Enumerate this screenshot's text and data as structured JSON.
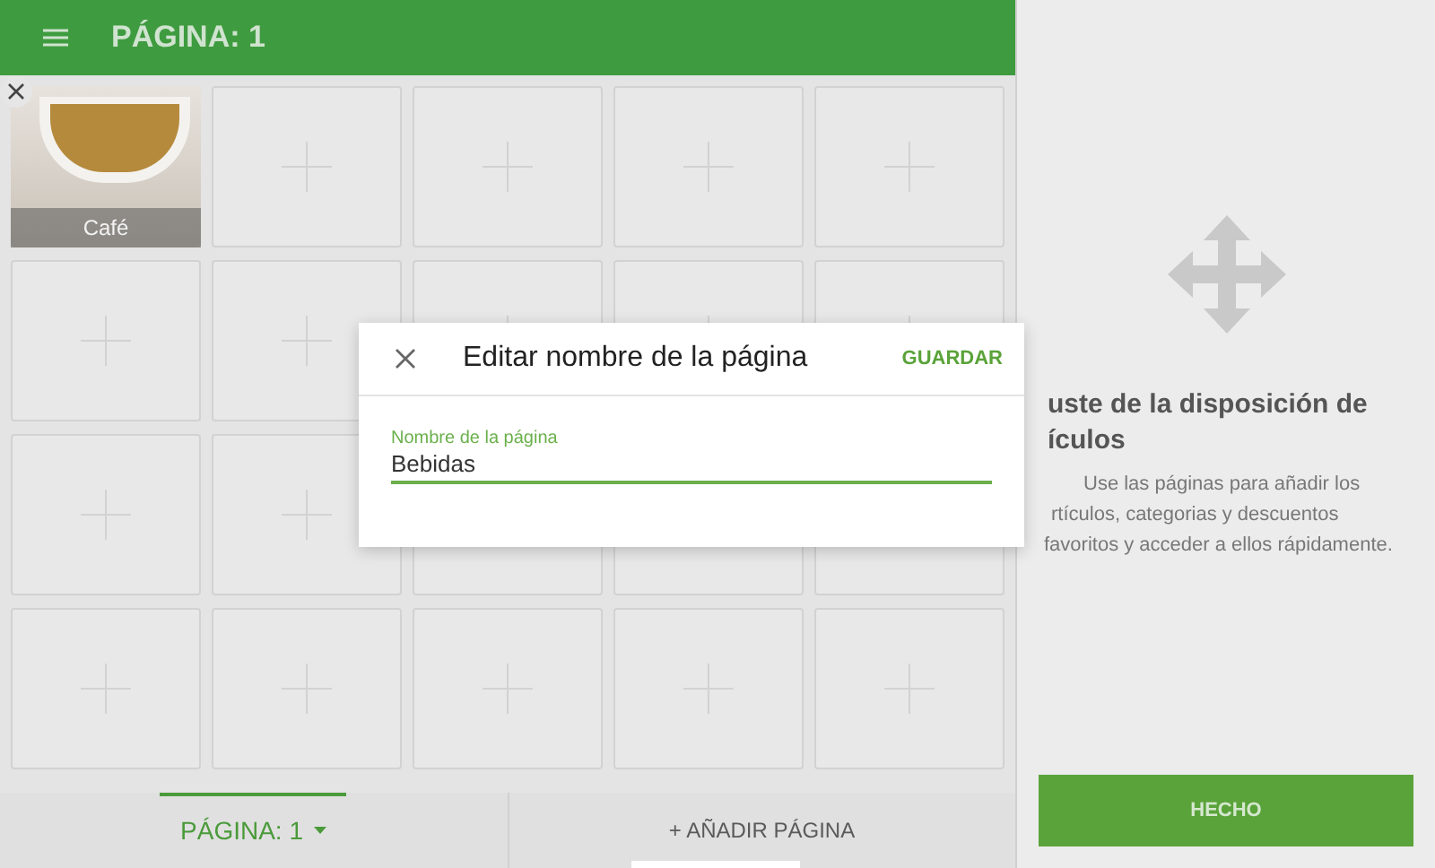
{
  "top_bar": {
    "title": "PÁGINA: 1"
  },
  "tiles": [
    {
      "kind": "item",
      "label": "Café"
    },
    {
      "kind": "empty"
    },
    {
      "kind": "empty"
    },
    {
      "kind": "empty"
    },
    {
      "kind": "empty"
    },
    {
      "kind": "empty"
    },
    {
      "kind": "empty"
    },
    {
      "kind": "empty"
    },
    {
      "kind": "empty"
    },
    {
      "kind": "empty"
    },
    {
      "kind": "empty"
    },
    {
      "kind": "empty"
    },
    {
      "kind": "empty"
    },
    {
      "kind": "empty"
    },
    {
      "kind": "empty"
    },
    {
      "kind": "empty"
    },
    {
      "kind": "empty"
    },
    {
      "kind": "empty"
    },
    {
      "kind": "empty"
    },
    {
      "kind": "empty"
    }
  ],
  "bottom_tabs": [
    {
      "label": "PÁGINA: 1",
      "selected": true
    },
    {
      "label": "+ AÑADIR PÁGINA",
      "selected": false
    }
  ],
  "side_panel": {
    "heading_lines": [
      "uste de la disposición de",
      "ículos"
    ],
    "description_lines": [
      "Use las páginas para añadir los",
      "rtículos, categorias y descuentos",
      "favoritos y acceder a ellos rápidamente."
    ],
    "done_button": "HECHO"
  },
  "dialog": {
    "title": "Editar nombre de la página",
    "save_button": "GUARDAR",
    "field": {
      "label": "Nombre de la página",
      "value": "Bebidas"
    }
  }
}
